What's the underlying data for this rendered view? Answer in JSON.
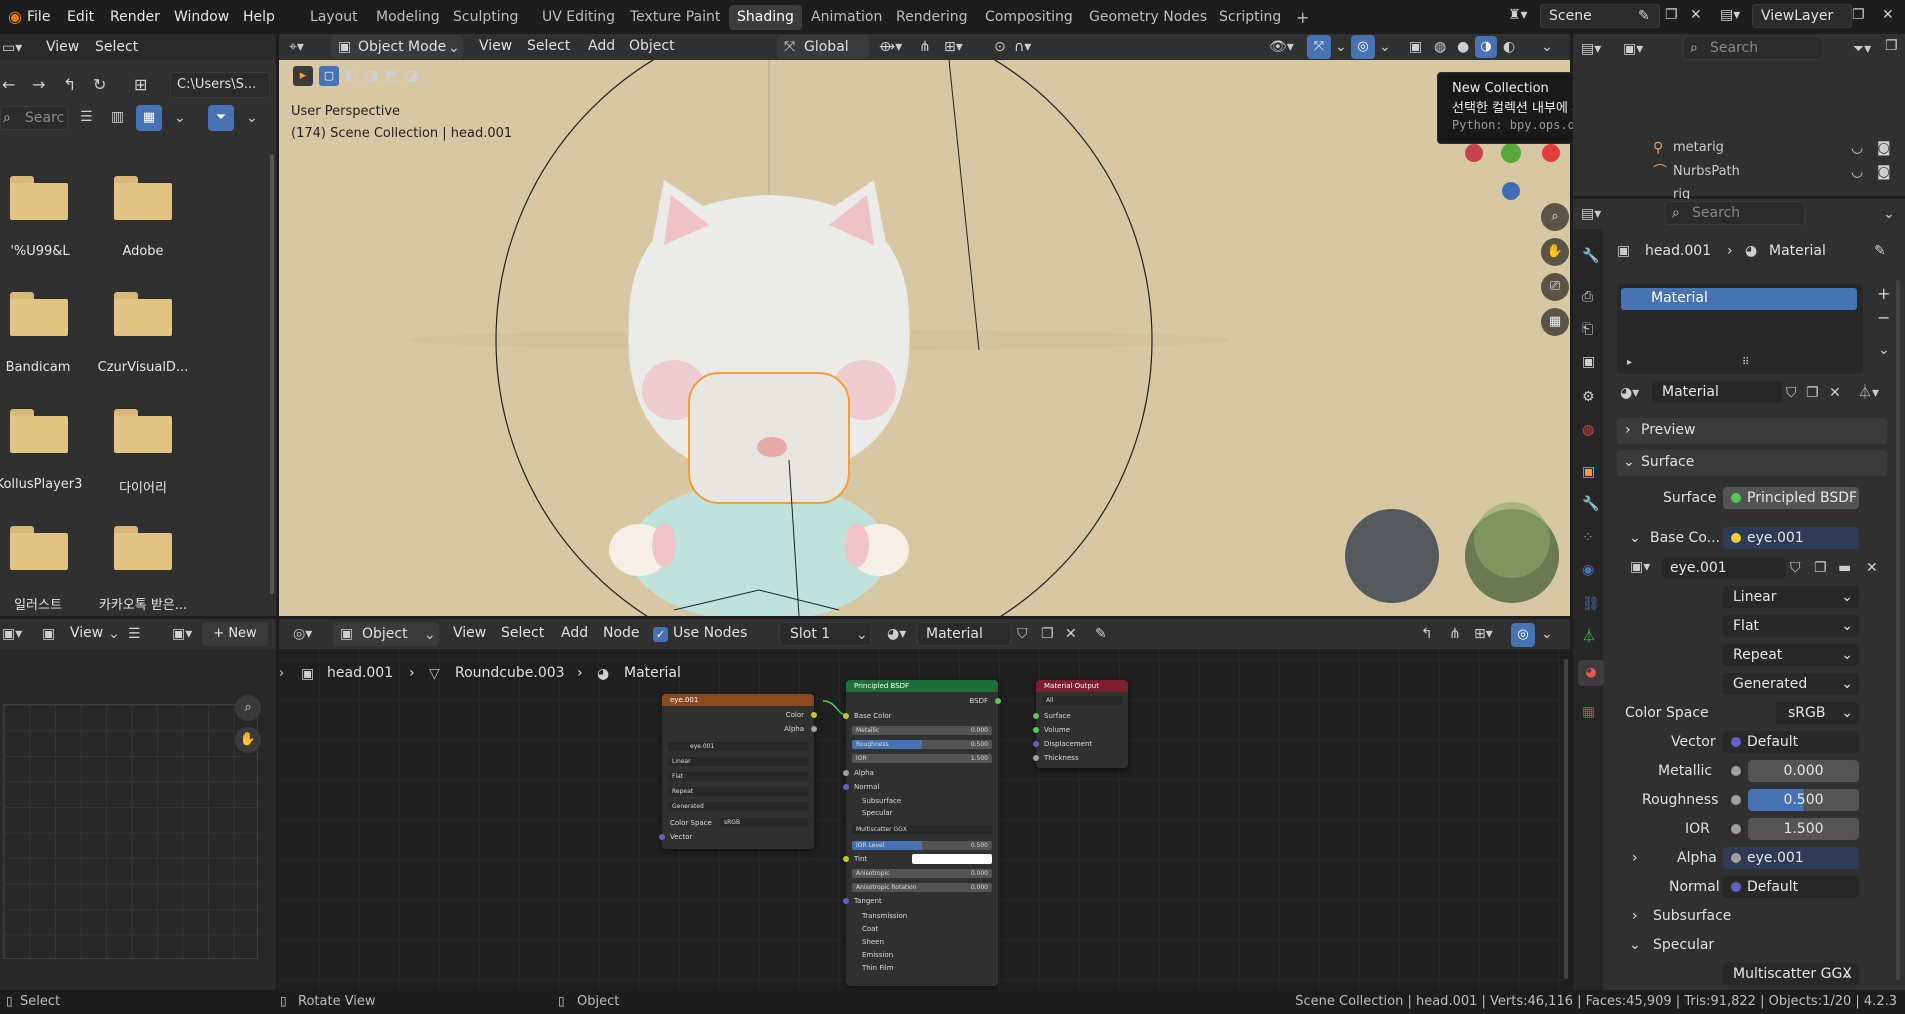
{
  "menus": [
    "File",
    "Edit",
    "Render",
    "Window",
    "Help"
  ],
  "workspaces": [
    "Layout",
    "Modeling",
    "Sculpting",
    "UV Editing",
    "Texture Paint",
    "Shading",
    "Animation",
    "Rendering",
    "Compositing",
    "Geometry Nodes",
    "Scripting"
  ],
  "active_workspace": "Shading",
  "plus": "+",
  "scene": "Scene",
  "view_layer": "ViewLayer",
  "file_browser": {
    "view": "View",
    "select": "Select",
    "path": "C:\\Users\\S...",
    "search_placeholder": "Searc",
    "folders": [
      "'%U99&L",
      "Adobe",
      "Bandicam",
      "CzurVisualD...",
      "KollusPlayer3",
      "다이어리",
      "일러스트",
      "카카오톡 받은..."
    ]
  },
  "viewport": {
    "mode": "Object Mode",
    "view": "View",
    "select": "Select",
    "add": "Add",
    "object": "Object",
    "orientation": "Global",
    "perspective": "User Perspective",
    "collection_info": "(174) Scene Collection | head.001"
  },
  "tooltip": {
    "title": "New Collection",
    "desc": "선택한 컬렉션 내부에 새 컬렉션을 추가.",
    "python": "Python: bpy.ops.outliner.collection_new(nested=True)"
  },
  "outliner": {
    "search": "Search",
    "items": [
      "metarig",
      "NurbsPath",
      "rig"
    ]
  },
  "image_editor": {
    "view": "View",
    "new": "New"
  },
  "node_editor": {
    "object": "Object",
    "view": "View",
    "select": "Select",
    "add": "Add",
    "node": "Node",
    "use_nodes": "Use Nodes",
    "slot": "Slot 1",
    "material": "Material",
    "breadcrumb": [
      "head.001",
      "Roundcube.003",
      "Material"
    ],
    "tex_node": {
      "title": "eye.001",
      "out_color": "Color",
      "out_alpha": "Alpha",
      "image": "eye.001",
      "interp": "Linear",
      "proj": "Flat",
      "ext": "Repeat",
      "src": "Generated",
      "cs_label": "Color Space",
      "cs": "sRGB",
      "vector": "Vector"
    },
    "bsdf_node": {
      "title": "Principled BSDF",
      "out": "BSDF",
      "base_color": "Base Color",
      "metallic": "Metallic",
      "metallic_v": "0.000",
      "roughness": "Roughness",
      "roughness_v": "0.500",
      "ior": "IOR",
      "ior_v": "1.500",
      "alpha": "Alpha",
      "normal": "Normal",
      "subsurface": "Subsurface",
      "specular": "Specular",
      "dist": "Multiscatter GGX",
      "ior_level": "IOR Level",
      "ior_level_v": "0.500",
      "tint": "Tint",
      "aniso": "Anisotropic",
      "aniso_v": "0.000",
      "aniso_rot": "Anisotropic Rotation",
      "aniso_rot_v": "0.000",
      "tangent": "Tangent",
      "transmission": "Transmission",
      "coat": "Coat",
      "sheen": "Sheen",
      "emission": "Emission",
      "thin_film": "Thin Film"
    },
    "output_node": {
      "title": "Material Output",
      "target": "All",
      "surface": "Surface",
      "volume": "Volume",
      "displacement": "Displacement",
      "thickness": "Thickness"
    }
  },
  "properties": {
    "search": "Search",
    "object": "head.001",
    "context": "Material",
    "slot": "Material",
    "material_name": "Material",
    "preview": "Preview",
    "surface_section": "Surface",
    "surface_label": "Surface",
    "surface_value": "Principled BSDF",
    "base_color_label": "Base Co...",
    "base_color_value": "eye.001",
    "image_name": "eye.001",
    "interp": "Linear",
    "proj": "Flat",
    "ext": "Repeat",
    "src": "Generated",
    "cs_label": "Color Space",
    "cs_value": "sRGB",
    "vector_label": "Vector",
    "vector_value": "Default",
    "metallic_label": "Metallic",
    "metallic_value": "0.000",
    "roughness_label": "Roughness",
    "roughness_value": "0.500",
    "ior_label": "IOR",
    "ior_value": "1.500",
    "alpha_label": "Alpha",
    "alpha_value": "eye.001",
    "normal_label": "Normal",
    "normal_value": "Default",
    "subsurface": "Subsurface",
    "specular": "Specular",
    "dist": "Multiscatter GGX"
  },
  "status": {
    "select": "Select",
    "rotate": "Rotate View",
    "object": "Object",
    "stats": "Scene Collection | head.001 | Verts:46,116 | Faces:45,909 | Tris:91,822 | Objects:1/20 | 4.2.3"
  },
  "colors": {
    "accent": "#4772b3",
    "bg": "#1d1d1d",
    "panel": "#303030",
    "viewport": "#d7c8a3",
    "selection": "#f39c3c"
  }
}
